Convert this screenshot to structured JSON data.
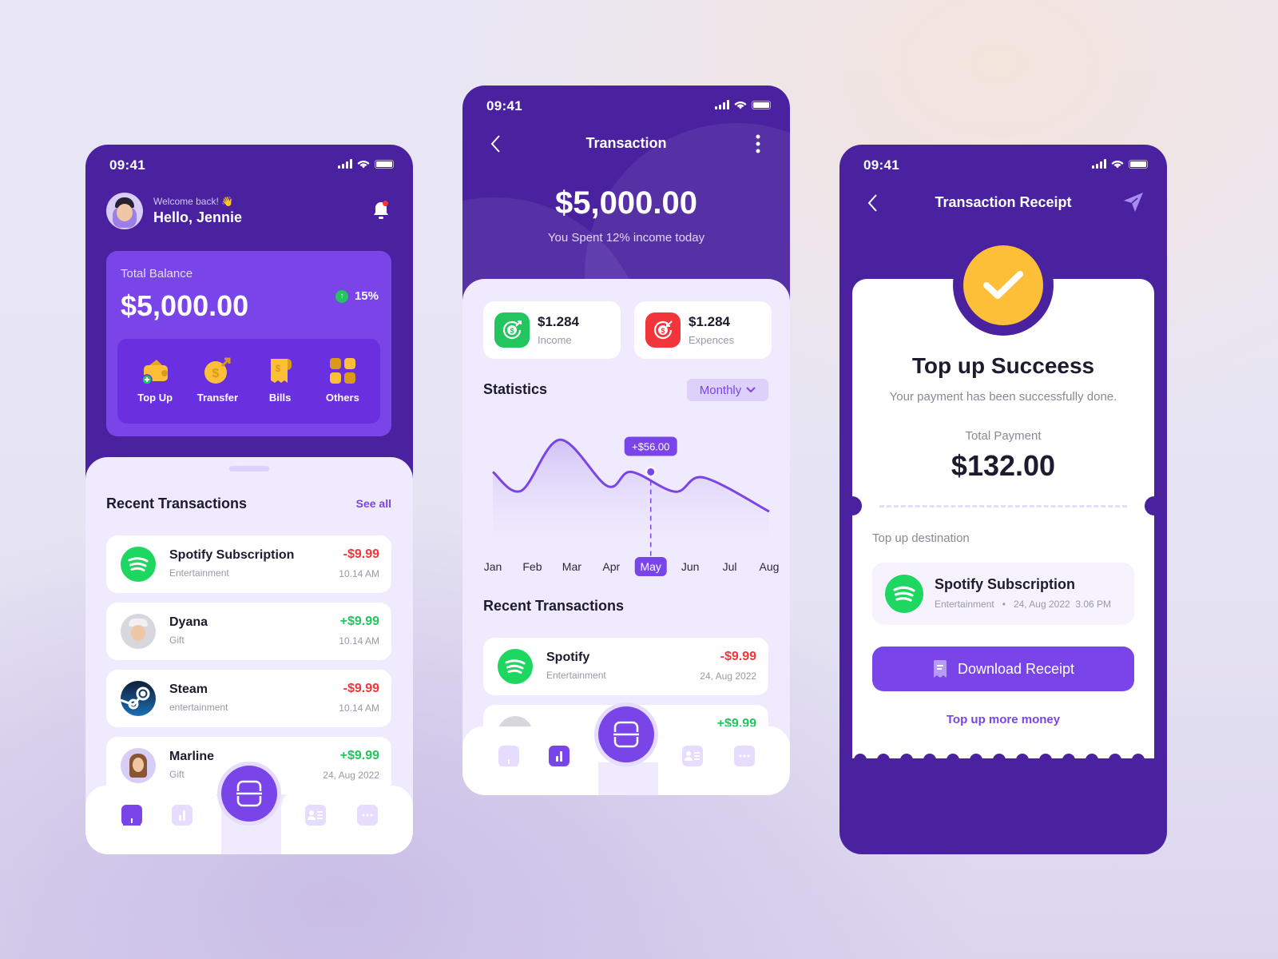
{
  "colors": {
    "primary_dark": "#4a22a0",
    "primary": "#7a45e8",
    "sheet": "#efeafd",
    "positive": "#22c55e",
    "negative": "#f2353a",
    "accent_yellow": "#fdbf38",
    "spotify_green": "#1ed760"
  },
  "phone1": {
    "status": {
      "time": "09:41"
    },
    "header": {
      "welcome": "Welcome back! 👋",
      "greeting": "Hello, Jennie"
    },
    "balance": {
      "label": "Total Balance",
      "amount": "$5,000.00",
      "growth": "15%"
    },
    "actions": [
      {
        "label": "Top Up",
        "icon": "wallet-plus-icon"
      },
      {
        "label": "Transfer",
        "icon": "coin-send-icon"
      },
      {
        "label": "Bills",
        "icon": "receipt-icon"
      },
      {
        "label": "Others",
        "icon": "grid-icon"
      }
    ],
    "recent": {
      "title": "Recent Transactions",
      "see_all": "See all",
      "items": [
        {
          "name": "Spotify Subscription",
          "category": "Entertainment",
          "amount": "-$9.99",
          "time": "10.14 AM",
          "type": "negative",
          "logo": "spotify"
        },
        {
          "name": "Dyana",
          "category": "Gift",
          "amount": "+$9.99",
          "time": "10.14 AM",
          "type": "positive",
          "logo": "avatar"
        },
        {
          "name": "Steam",
          "category": "entertainment",
          "amount": "-$9.99",
          "time": "10.14 AM",
          "type": "negative",
          "logo": "steam"
        },
        {
          "name": "Marline",
          "category": "Gift",
          "amount": "+$9.99",
          "time": "24, Aug 2022",
          "type": "positive",
          "logo": "avatar"
        }
      ]
    },
    "nav": {
      "active": "home"
    }
  },
  "phone2": {
    "status": {
      "time": "09:41"
    },
    "title": "Transaction",
    "amount": "$5,000.00",
    "subtitle": "You Spent 12% income today",
    "income": {
      "value": "$1.284",
      "label": "Income"
    },
    "expenses": {
      "value": "$1.284",
      "label": "Expences"
    },
    "statistics": {
      "title": "Statistics",
      "period": "Monthly"
    },
    "recent": {
      "title": "Recent Transactions",
      "items": [
        {
          "name": "Spotify",
          "category": "Entertainment",
          "amount": "-$9.99",
          "time": "24, Aug 2022",
          "type": "negative"
        },
        {
          "name": "",
          "category": "",
          "amount": "+$9.99",
          "time": "",
          "type": "positive"
        }
      ]
    },
    "nav": {
      "active": "stats"
    }
  },
  "chart_data": {
    "type": "area",
    "title": "Statistics",
    "categories": [
      "Jan",
      "Feb",
      "Mar",
      "Apr",
      "May",
      "Jun",
      "Jul",
      "Aug"
    ],
    "selected_category": "May",
    "tooltip": "+$56.00",
    "series": [
      {
        "name": "Monthly",
        "points": [
          {
            "x": 0.0,
            "y": 58
          },
          {
            "x": 0.72,
            "y": 38
          },
          {
            "x": 1.7,
            "y": 92
          },
          {
            "x": 2.9,
            "y": 43
          },
          {
            "x": 3.5,
            "y": 58
          },
          {
            "x": 4.62,
            "y": 37
          },
          {
            "x": 5.34,
            "y": 52
          },
          {
            "x": 7.0,
            "y": 16
          }
        ]
      }
    ],
    "ylim": [
      0,
      110
    ],
    "grid": false,
    "legend": "none"
  },
  "phone3": {
    "status": {
      "time": "09:41"
    },
    "title": "Transaction Receipt",
    "success_title": "Top up Succeess",
    "success_sub": "Your payment has been successfully done.",
    "total_label": "Total Payment",
    "total": "$132.00",
    "destination_label": "Top up destination",
    "destination": {
      "name": "Spotify Subscription",
      "category": "Entertainment",
      "datetime": "24, Aug 2022  3.06 PM"
    },
    "download": "Download Receipt",
    "more": "Top up more money"
  }
}
